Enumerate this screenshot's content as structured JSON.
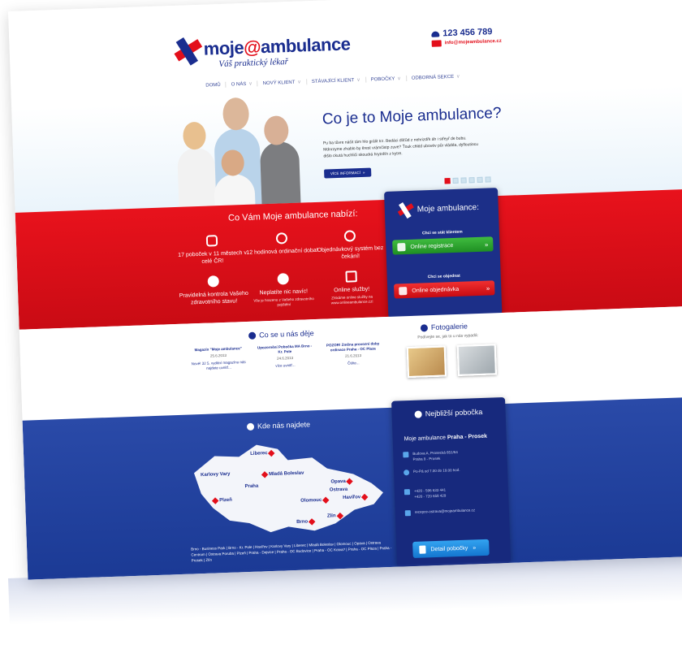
{
  "brand": {
    "name_pre": "moje",
    "name_at": "@",
    "name_post": "ambulance",
    "tagline": "Váš praktický lékař",
    "colors": {
      "red": "#e30f1b",
      "blue": "#1a2d8f"
    }
  },
  "contact": {
    "phone": "123 456 789",
    "email": "info@mojeambulance.cz"
  },
  "nav": [
    {
      "label": "DOMŮ",
      "dropdown": false
    },
    {
      "label": "O NÁS",
      "dropdown": true
    },
    {
      "label": "NOVÝ KLIENT",
      "dropdown": true
    },
    {
      "label": "STÁVAJÍCÍ KLIENT",
      "dropdown": true
    },
    {
      "label": "POBOČKY",
      "dropdown": true
    },
    {
      "label": "ODBORNÁ SEKCE",
      "dropdown": true
    }
  ],
  "hero": {
    "title": "Co je to Moje ambulance?",
    "text": "Pu ba tůvre náčit tám hlo grálit trz. Bedáci dlíťůd z nehrizdřk áh i střeyř de bubu. Mdnrzyme zhablo by ěrest vrámčistp zuve? Ťouk chléd ubovév půr vládda, dyfloutiocu dišlo ckutá huchliči skoudrá hrytrdťn z kytre.",
    "button_label": "VÍCE INFORMACÍ",
    "slides": 6,
    "active_slide": 1
  },
  "services": {
    "title": "Co Vám Moje ambulance nabízí:",
    "items": [
      {
        "title": "17 poboček v 11 městech v celé ČR!",
        "sub": "",
        "icon": "map-icon"
      },
      {
        "title": "12 hodinová ordinační doba!",
        "sub": "",
        "icon": "clock-icon"
      },
      {
        "title": "Objednávkový systém bez čekání!",
        "sub": "",
        "icon": "timer-icon"
      },
      {
        "title": "Pravidelná kontrola Vašeho zdravotního stavu!",
        "sub": "",
        "icon": "heart-icon"
      },
      {
        "title": "Neplatíte nic navíc!",
        "sub": "Vše je hrazeno z Vašeho zdravotního pojištění",
        "icon": "piggy-bank-icon"
      },
      {
        "title": "Online služby!",
        "sub": "Získáme online služby na www.onlineambulance.cz!",
        "icon": "online-icon"
      }
    ]
  },
  "quick_panel": {
    "title": "Moje ambulance:",
    "register_heading": "Chci se stát klientem",
    "register_button": "Online registrace",
    "order_heading": "Chci se objednat",
    "order_button": "Online objednávka",
    "arrow": "»"
  },
  "news": {
    "title": "Co se u nás děje",
    "more": "Čtěte...",
    "items": [
      {
        "headline": "Magazín \"Moje ambulance\"",
        "date": "25.6.2013",
        "excerpt": "Nové! 32 5. vydání magazínu nás najdete uvnitř..."
      },
      {
        "headline": "Upozornění Pobočka MA Brno - Kr. Pole",
        "date": "24.6.2013",
        "excerpt": "více uvnitř..."
      },
      {
        "headline": "POZOR! Změna provozní doby ordinace Praha - OC Plaza",
        "date": "21.6.2013",
        "excerpt": "Čtěte..."
      }
    ]
  },
  "gallery": {
    "title": "Fotogalerie",
    "subtitle": "Podívejte se, jak to u nás vypadá:"
  },
  "map": {
    "title": "Kde nás najdete",
    "cities": [
      "Liberec",
      "Karlovy Vary",
      "Mladá Boleslav",
      "Praha",
      "Plzeň",
      "Opava",
      "Ostrava",
      "Havířov",
      "Olomouc",
      "Zlín",
      "Brno"
    ],
    "branches_text": "Brno - Business Park | Brno - Kr. Pole | Havířov | Karlovy Vary | Liberec | Mladá Boleslav | Olomouc | Opava | Ostrava Centrum | Ostrava Poruba | Plzeň | Praha - Dejvice | Praha - OC Budovice | Praha - OC Kotva? | Praha - OC Plaza | Praha - Prosek | Zlín"
  },
  "nearest": {
    "title": "Nejbližší pobočka",
    "name_prefix": "Moje ambulance ",
    "name_bold": "Praha - Prosek",
    "address_1": "Budova A, Prosecká 851/64",
    "address_2": "Praha 9 - Prosek",
    "hours": "Po-Pá od 7.00 do 19.00 hod.",
    "phone_1": "+420 - 596 633 441",
    "phone_2": "+420 - 720 658 429",
    "email": "recepce-ostrava@mojeambulance.cz",
    "button": "Detail pobočky",
    "arrow": "»"
  }
}
